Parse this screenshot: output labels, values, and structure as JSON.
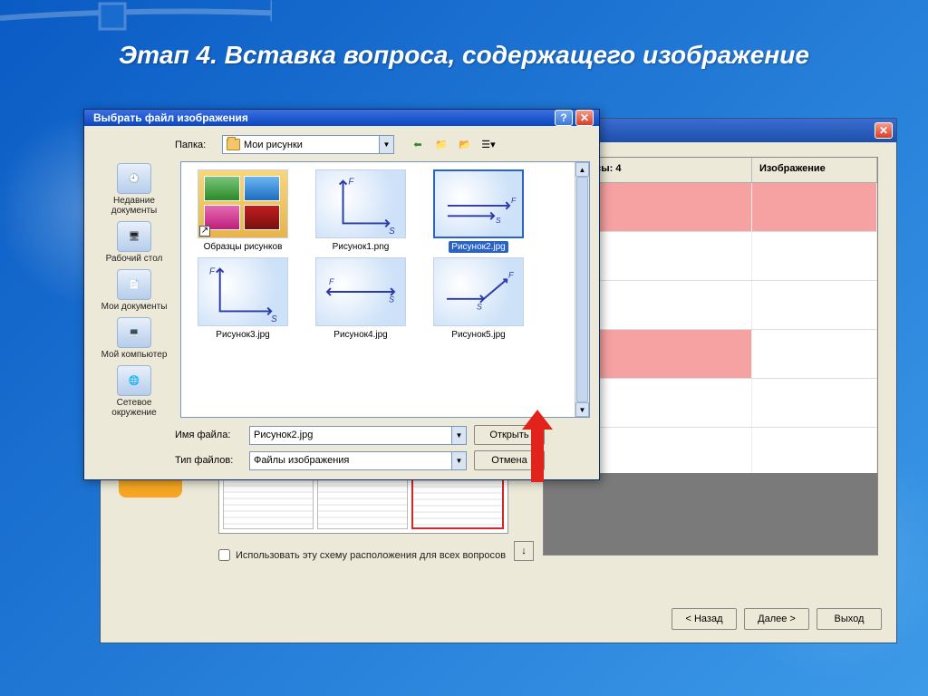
{
  "slide": {
    "title": "Этап 4. Вставка вопроса, содержащего изображение"
  },
  "wizard": {
    "table": {
      "header1": "на вопросы: 4",
      "header2": "Изображение"
    },
    "layout_checkbox_label": "Использовать эту схему расположения для всех вопросов",
    "buttons": {
      "back": "< Назад",
      "next": "Далее >",
      "exit": "Выход"
    }
  },
  "dialog": {
    "title": "Выбрать файл изображения",
    "folder_label": "Папка:",
    "folder_value": "Мои рисунки",
    "places": [
      {
        "id": "recent",
        "label": "Недавние документы"
      },
      {
        "id": "desktop",
        "label": "Рабочий стол"
      },
      {
        "id": "mydocs",
        "label": "Мои документы"
      },
      {
        "id": "mycomp",
        "label": "Мой компьютер"
      },
      {
        "id": "network",
        "label": "Сетевое окружение"
      }
    ],
    "files": [
      {
        "label": "Образцы рисунков",
        "type": "folder"
      },
      {
        "label": "Рисунок1.png",
        "type": "img"
      },
      {
        "label": "Рисунок2.jpg",
        "type": "img",
        "selected": true
      },
      {
        "label": "Рисунок3.jpg",
        "type": "img"
      },
      {
        "label": "Рисунок4.jpg",
        "type": "img"
      },
      {
        "label": "Рисунок5.jpg",
        "type": "img"
      }
    ],
    "filename_label": "Имя файла:",
    "filename_value": "Рисунок2.jpg",
    "filetype_label": "Тип файлов:",
    "filetype_value": "Файлы изображения",
    "open_btn": "Открыть",
    "cancel_btn": "Отмена"
  }
}
